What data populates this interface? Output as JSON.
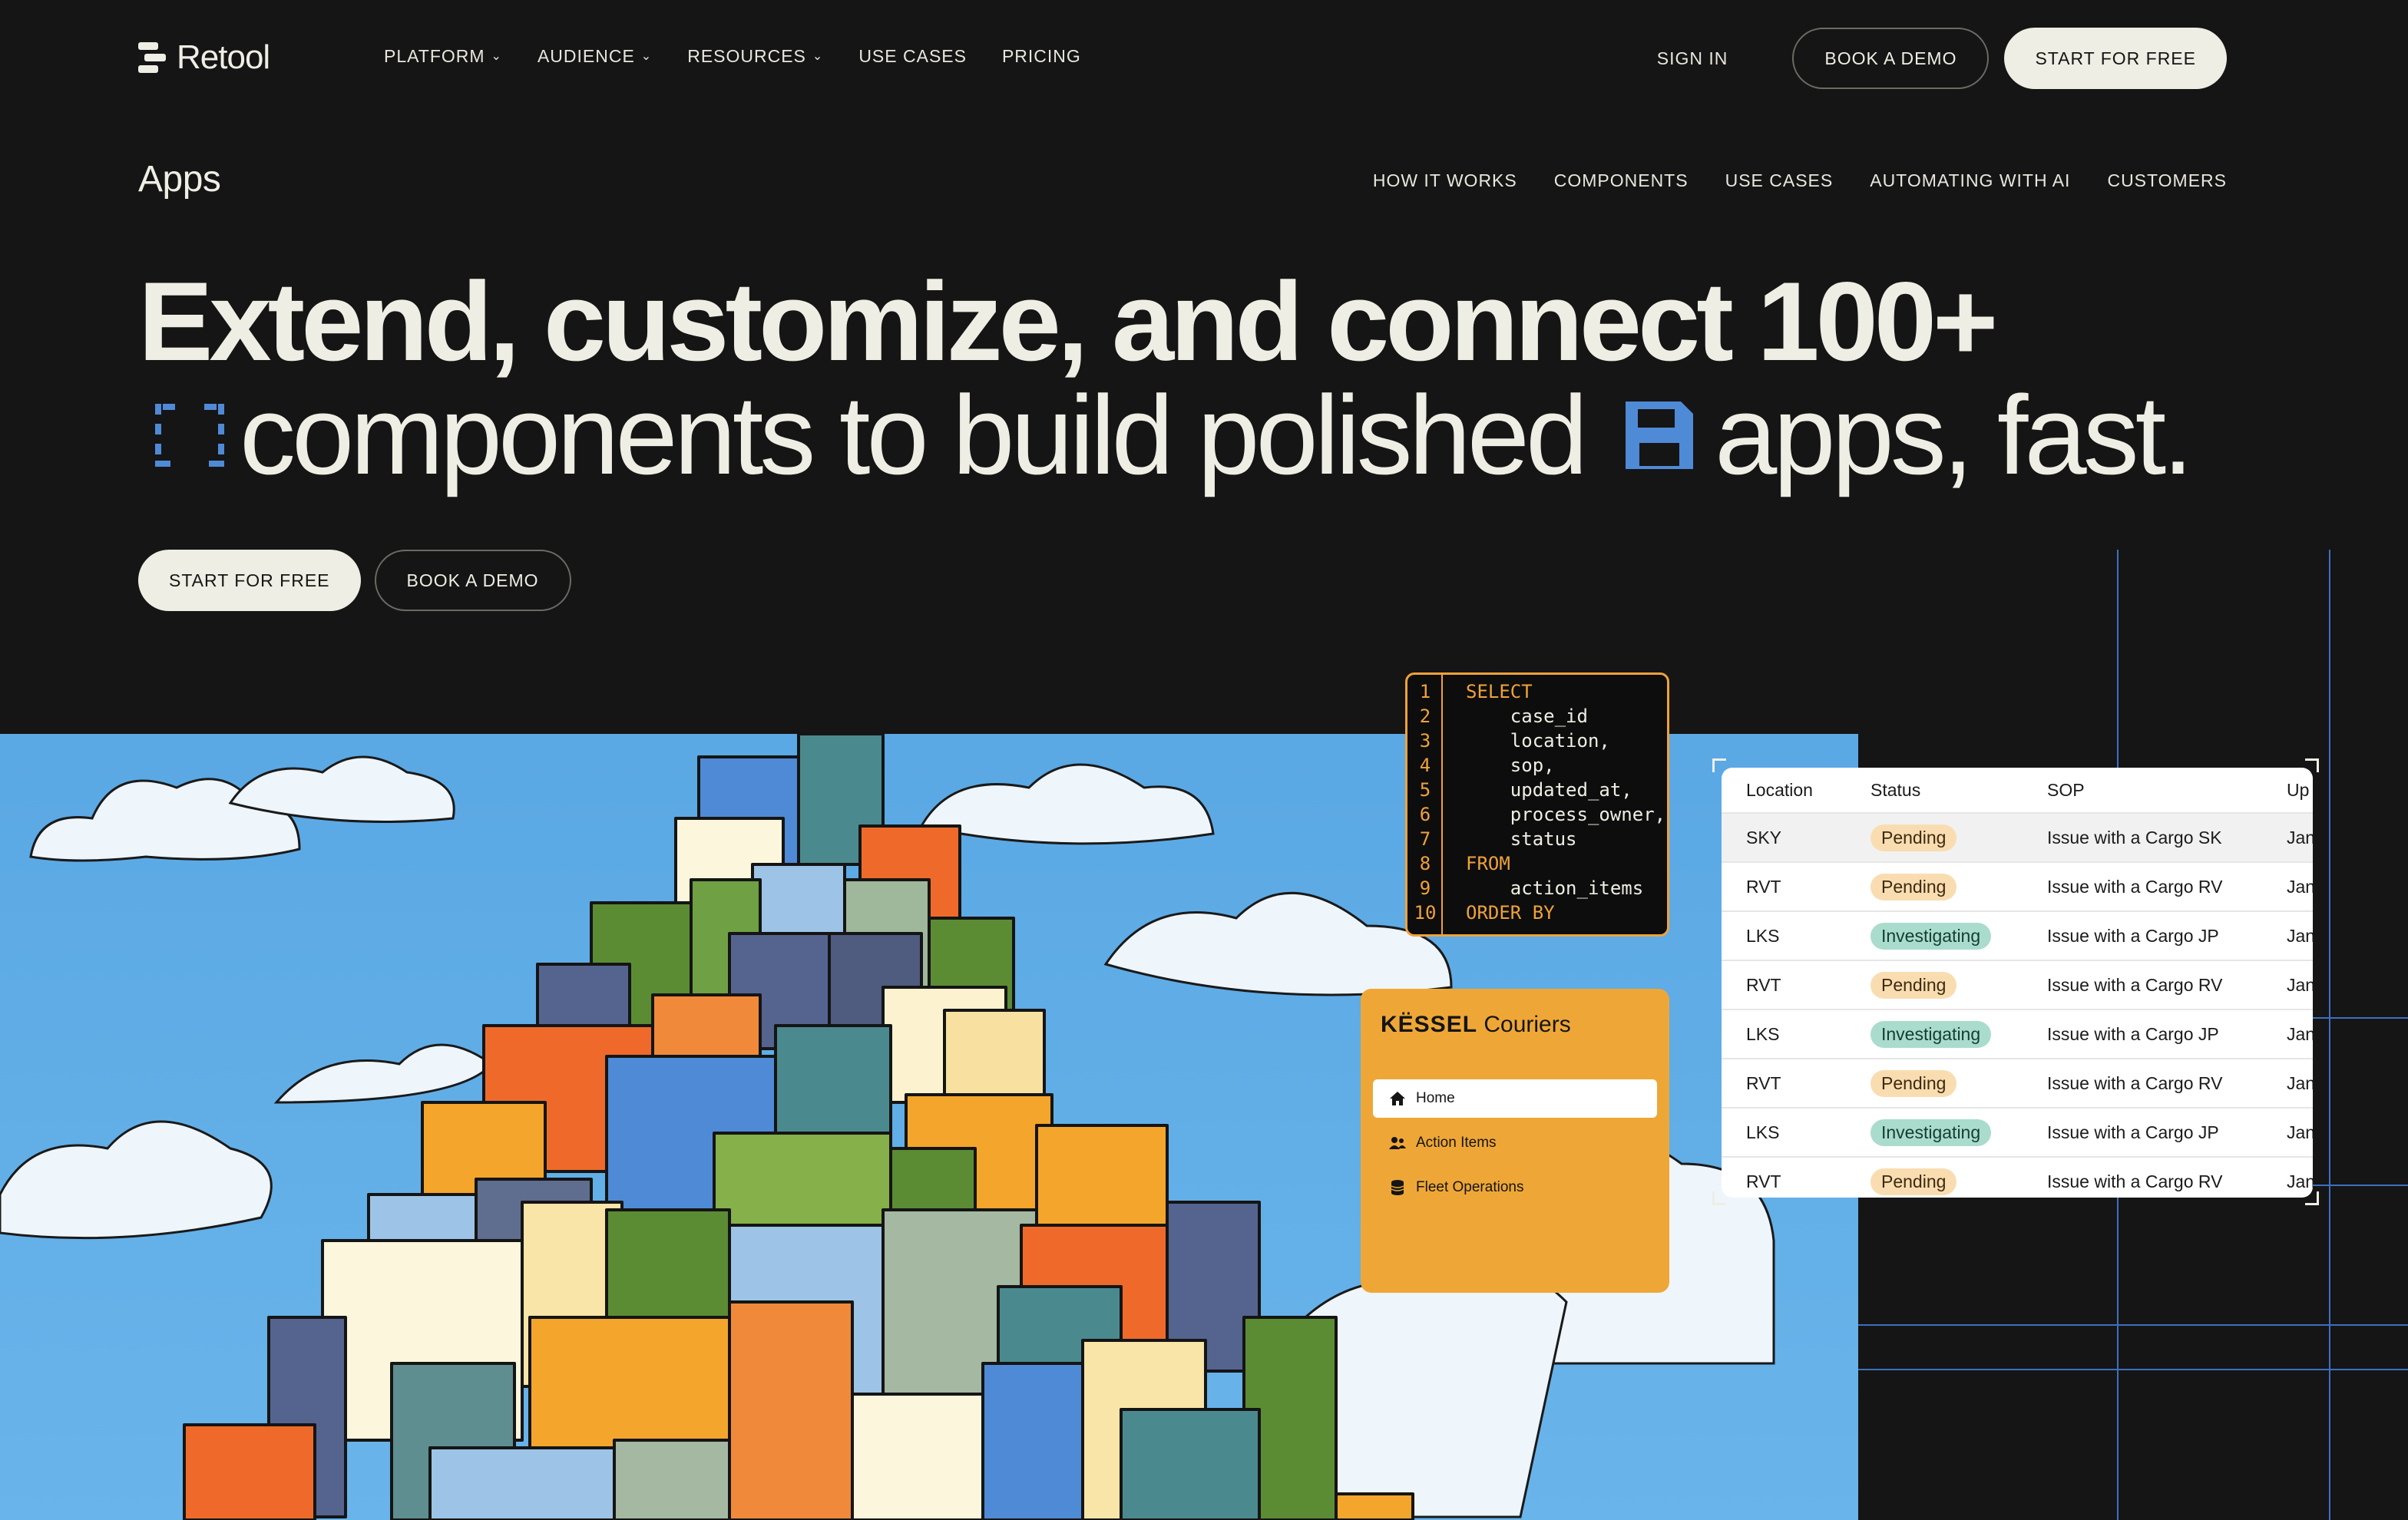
{
  "brand": {
    "name": "Retool"
  },
  "nav": {
    "items": [
      {
        "label": "PLATFORM",
        "dropdown": true
      },
      {
        "label": "AUDIENCE",
        "dropdown": true
      },
      {
        "label": "RESOURCES",
        "dropdown": true
      },
      {
        "label": "USE CASES",
        "dropdown": false
      },
      {
        "label": "PRICING",
        "dropdown": false
      }
    ],
    "sign_in": "SIGN IN",
    "book_demo": "BOOK A DEMO",
    "start_free": "START FOR FREE"
  },
  "subnav": {
    "title": "Apps",
    "items": [
      "HOW IT WORKS",
      "COMPONENTS",
      "USE CASES",
      "AUTOMATING WITH AI",
      "CUSTOMERS"
    ]
  },
  "hero": {
    "line1": "Extend, customize, and connect 100+",
    "line2a": "components to build polished",
    "line2b": "apps, fast.",
    "cta_primary": "START FOR FREE",
    "cta_secondary": "BOOK A DEMO"
  },
  "code": {
    "lines": [
      {
        "n": "1",
        "kw": "SELECT",
        "text": ""
      },
      {
        "n": "2",
        "kw": "",
        "text": "    case_id"
      },
      {
        "n": "3",
        "kw": "",
        "text": "    location,"
      },
      {
        "n": "4",
        "kw": "",
        "text": "    sop,"
      },
      {
        "n": "5",
        "kw": "",
        "text": "    updated_at,"
      },
      {
        "n": "6",
        "kw": "",
        "text": "    process_owner,"
      },
      {
        "n": "7",
        "kw": "",
        "text": "    status"
      },
      {
        "n": "8",
        "kw": "FROM",
        "text": ""
      },
      {
        "n": "9",
        "kw": "",
        "text": "    action_items"
      },
      {
        "n": "10",
        "kw": "ORDER BY",
        "text": ""
      }
    ]
  },
  "kessel": {
    "brand_bold": "KËSSEL",
    "brand_rest": " Couriers",
    "menu": [
      {
        "label": "Home",
        "icon": "home-icon",
        "active": true
      },
      {
        "label": "Action Items",
        "icon": "users-icon",
        "active": false
      },
      {
        "label": "Fleet Operations",
        "icon": "database-icon",
        "active": false
      }
    ]
  },
  "table": {
    "headers": [
      "Location",
      "Status",
      "SOP",
      "Up"
    ],
    "rows": [
      {
        "location": "SKY",
        "status": "Pending",
        "sop": "Issue with a Cargo SK",
        "updated": "Jan"
      },
      {
        "location": "RVT",
        "status": "Pending",
        "sop": "Issue with a Cargo RV",
        "updated": "Jan"
      },
      {
        "location": "LKS",
        "status": "Investigating",
        "sop": "Issue with a Cargo JP",
        "updated": "Jan"
      },
      {
        "location": "RVT",
        "status": "Pending",
        "sop": "Issue with a Cargo RV",
        "updated": "Jan"
      },
      {
        "location": "LKS",
        "status": "Investigating",
        "sop": "Issue with a Cargo JP",
        "updated": "Jan"
      },
      {
        "location": "RVT",
        "status": "Pending",
        "sop": "Issue with a Cargo RV",
        "updated": "Jan"
      },
      {
        "location": "LKS",
        "status": "Investigating",
        "sop": "Issue with a Cargo JP",
        "updated": "Jan"
      },
      {
        "location": "RVT",
        "status": "Pending",
        "sop": "Issue with a Cargo RV",
        "updated": "Jan"
      }
    ]
  },
  "colors": {
    "background": "#151515",
    "cream": "#efeee4",
    "sky": "#5aa8e4",
    "accent_orange": "#f0a23a",
    "icon_blue": "#4f8ad6",
    "grid_line": "#3d6fbf"
  }
}
